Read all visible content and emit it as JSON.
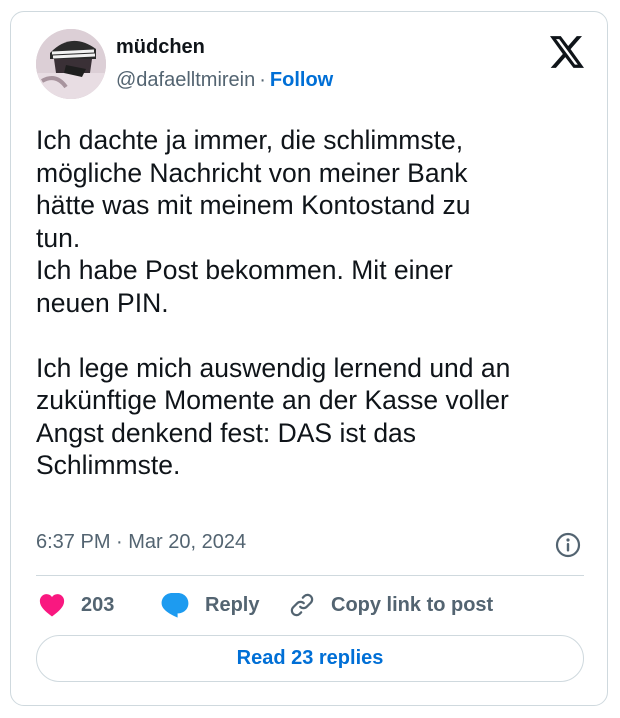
{
  "author": {
    "display_name": "müdchen",
    "handle": "@dafaelltmirein",
    "separator": "·",
    "follow_label": "Follow"
  },
  "tweet": {
    "text": "Ich dachte ja immer, die schlimmste,\nmögliche Nachricht von meiner Bank\nhätte was mit meinem Kontostand zu\ntun.\nIch habe Post bekommen. Mit einer\nneuen PIN.\n\nIch lege mich auswendig lernend und an\nzukünftige Momente an der Kasse voller\nAngst denkend fest: DAS ist das\nSchlimmste.",
    "timestamp": "6:37 PM · Mar 20, 2024"
  },
  "actions": {
    "like_count": "203",
    "reply_label": "Reply",
    "copy_link_label": "Copy link to post",
    "read_replies_label": "Read 23 replies"
  },
  "icons": {
    "brand": "x-logo-icon",
    "info": "info-icon",
    "like": "heart-icon",
    "reply": "speech-bubble-icon",
    "copy": "link-icon"
  },
  "colors": {
    "text": "#0f1419",
    "secondary_text": "#536471",
    "link": "#006fd6",
    "border": "#cfd9de",
    "heart": "#f91880",
    "reply_bubble": "#1d9bf0"
  }
}
